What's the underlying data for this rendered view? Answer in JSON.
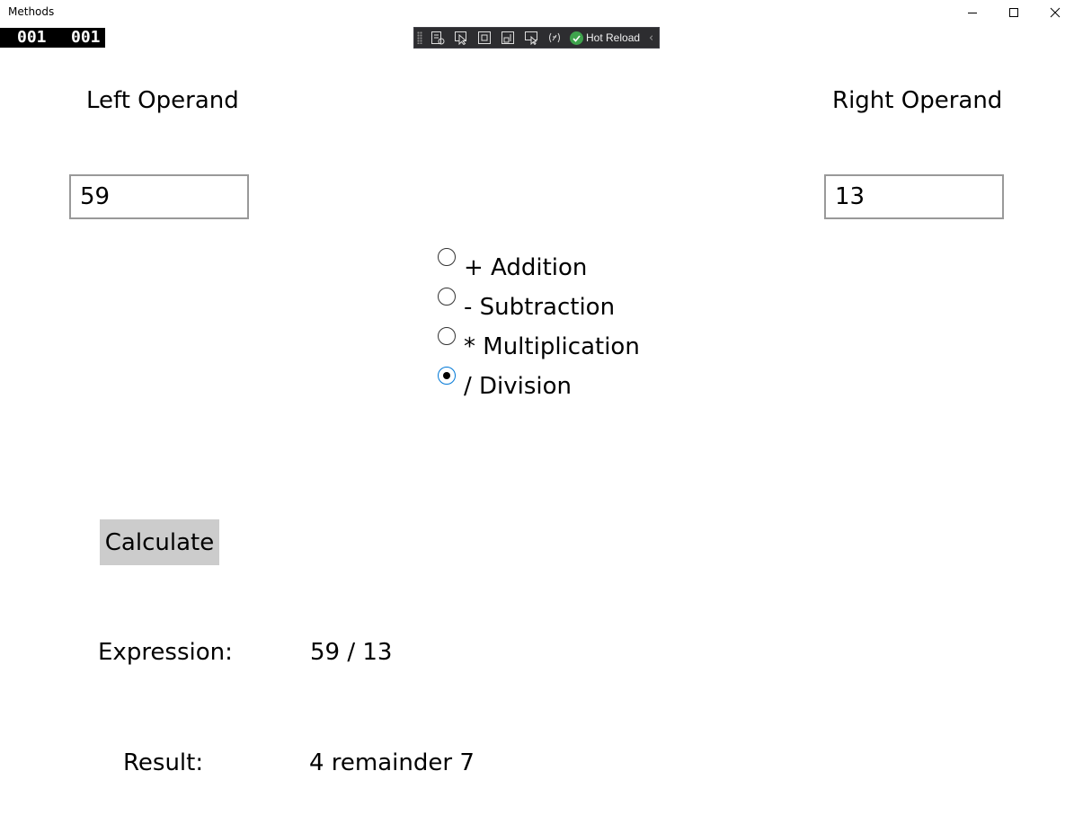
{
  "window": {
    "title": "Methods",
    "minimize_icon": "minimize-icon",
    "maximize_icon": "maximize-icon",
    "close_icon": "close-icon"
  },
  "frame_counter": {
    "left": "001",
    "right": "001"
  },
  "debug_toolbar": {
    "icons": [
      "live-visual-tree-icon",
      "select-element-icon",
      "display-layout-adorners-icon",
      "track-focus-icon",
      "preview-selection-icon",
      "binding-failures-icon"
    ],
    "hot_reload_label": "Hot Reload",
    "collapse_glyph": "‹"
  },
  "operands": {
    "left_label": "Left Operand",
    "left_value": "59",
    "right_label": "Right Operand",
    "right_value": "13"
  },
  "operators": [
    {
      "label": "+ Addition",
      "checked": false
    },
    {
      "label": "- Subtraction",
      "checked": false
    },
    {
      "label": "* Multiplication",
      "checked": false
    },
    {
      "label": "/ Division",
      "checked": true
    }
  ],
  "calculate_label": "Calculate",
  "expression": {
    "label": "Expression:",
    "value": "59 / 13"
  },
  "result": {
    "label": "Result:",
    "value": "4 remainder 7"
  }
}
